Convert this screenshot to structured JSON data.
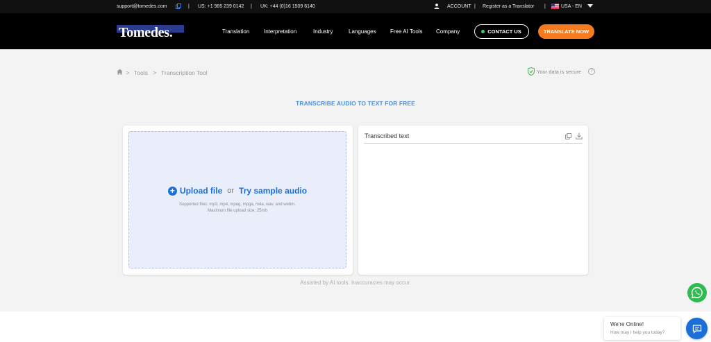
{
  "topbar": {
    "email": "support@tomedes.com",
    "separator": "|",
    "us_phone": "US: +1 985 239 0142",
    "uk_phone": "UK: +44 (0)16 1509 6140",
    "account": "ACCOUNT",
    "register": "Register as a Translator",
    "locale": "USA - EN"
  },
  "nav": {
    "logo": "Tomedes.",
    "links": [
      "Translation",
      "Interpretation",
      "Industry",
      "Languages",
      "Free AI Tools",
      "Company"
    ],
    "contact": "CONTACT US",
    "translate_now": "TRANSLATE NOW"
  },
  "breadcrumb": {
    "chevron": ">",
    "tools": "Tools",
    "current": "Transcription Tool"
  },
  "secure": {
    "label": "Your data is secure",
    "help": "?"
  },
  "subtitle": "TRANSCRIBE AUDIO TO TEXT FOR FREE",
  "upload": {
    "plus": "+",
    "upload_label": "Upload file",
    "or_label": "or",
    "sample_label": "Try sample audio",
    "supported": "Supported files: mp3, mp4, mpeg, mpga, m4a, wav, and webm.",
    "max_size": "Maximum file upload size: 25mb"
  },
  "transcribed": {
    "title": "Transcribed text"
  },
  "disclaimer": "Assisted by AI tools. Inaccuracies may occur.",
  "chat": {
    "online": "We're Online!",
    "help": "How may I help you today?"
  },
  "colors": {
    "accent_blue": "#1a6fd8",
    "orange": "#f47b20",
    "whatsapp_green": "#2fbb4f",
    "subtitle_blue": "#4a90e2"
  }
}
